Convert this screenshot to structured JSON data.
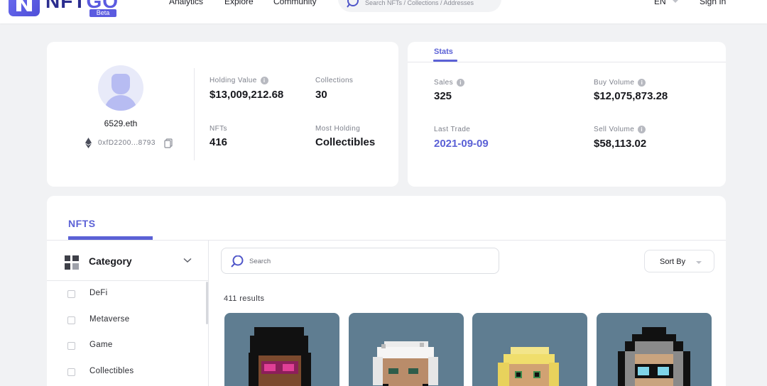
{
  "nav": {
    "logo_text": "NFT",
    "logo_text_accent": "GO",
    "beta_label": "Beta",
    "links": [
      "Analytics",
      "Explore",
      "Community"
    ],
    "search_placeholder": "Search NFTs / Collections / Addresses",
    "language": "EN",
    "sign_in": "Sign In"
  },
  "profile": {
    "ens_name": "6529.eth",
    "address": "0xfD2200...8793",
    "holding_value_label": "Holding Value",
    "holding_value": "$13,009,212.68",
    "collections_label": "Collections",
    "collections": "30",
    "nfts_label": "NFTs",
    "nfts": "416",
    "most_holding_label": "Most Holding",
    "most_holding": "Collectibles"
  },
  "stats": {
    "tab": "Stats",
    "sales_label": "Sales",
    "sales": "325",
    "buy_volume_label": "Buy Volume",
    "buy_volume": "$12,075,873.28",
    "last_trade_label": "Last Trade",
    "last_trade": "2021-09-09",
    "sell_volume_label": "Sell Volume",
    "sell_volume": "$58,113.02"
  },
  "nfts_section": {
    "tab": "NFTS",
    "category_title": "Category",
    "categories": [
      "DeFi",
      "Metaverse",
      "Game",
      "Collectibles"
    ],
    "search_placeholder": "Search",
    "sort_label": "Sort By",
    "results": "411 results"
  },
  "colors": {
    "accent": "#5b61d6",
    "nft_background": "#5f7d91"
  }
}
